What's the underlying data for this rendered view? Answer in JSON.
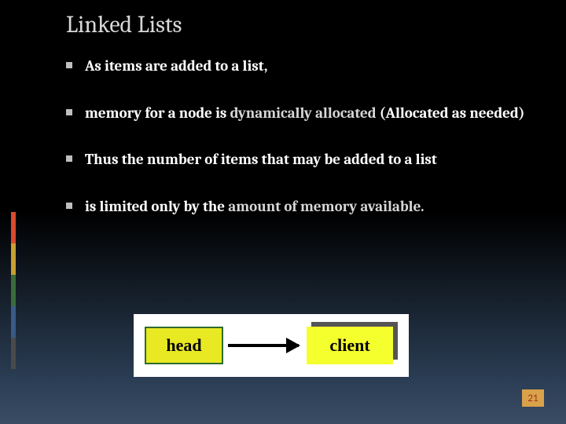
{
  "title": "Linked Lists",
  "bullets": [
    {
      "pre": "As items are added to a list,",
      "hl": "",
      "post": ""
    },
    {
      "pre": " memory for a node is ",
      "hl": "dynamically allocated ",
      "post": "(Allocated as needed)"
    },
    {
      "pre": "Thus the number of items that may be added to a list",
      "hl": "",
      "post": ""
    },
    {
      "pre": "is limited only by the ",
      "hl": "amount of memory available.",
      "post": ""
    }
  ],
  "diagram": {
    "box1": "head",
    "box2": "client"
  },
  "accent_colors": [
    "#d94a2e",
    "#c8a030",
    "#3a6b3a",
    "#3a5a88",
    "#4a4a4a"
  ],
  "page_number": "21"
}
